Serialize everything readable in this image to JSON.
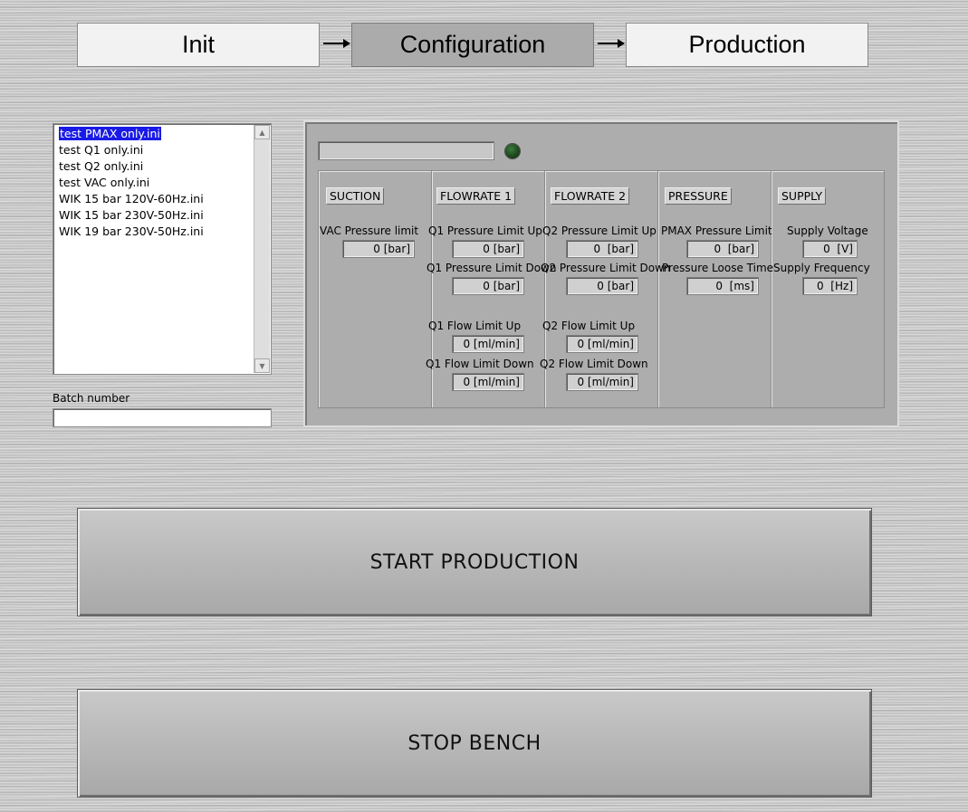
{
  "steps": [
    {
      "label": "Init",
      "active": false
    },
    {
      "label": "Configuration",
      "active": true
    },
    {
      "label": "Production",
      "active": false
    }
  ],
  "file_list": {
    "items": [
      "test PMAX only.ini",
      "test Q1 only.ini",
      "test Q2 only.ini",
      "test VAC only.ini",
      "WIK 15 bar 120V-60Hz.ini",
      "WIK 15 bar 230V-50Hz.ini",
      "WIK 19 bar 230V-50Hz.ini"
    ],
    "selected": "test PMAX only.ini"
  },
  "batch": {
    "label": "Batch number",
    "value": ""
  },
  "status": {
    "text": "",
    "led_color": "#1d4a1d"
  },
  "sections": {
    "suction": {
      "title": "SUCTION",
      "vac_label": "VAC Pressure limit",
      "vac_value": "0 [bar]"
    },
    "flowrate1": {
      "title": "FLOWRATE 1",
      "p_up_label": "Q1 Pressure Limit Up",
      "p_up_value": "0 [bar]",
      "p_down_label": "Q1 Pressure Limit Down",
      "p_down_value": "0 [bar]",
      "f_up_label": "Q1 Flow Limit Up",
      "f_up_value": "0 [ml/min]",
      "f_down_label": "Q1 Flow Limit Down",
      "f_down_value": "0 [ml/min]"
    },
    "flowrate2": {
      "title": "FLOWRATE 2",
      "p_up_label": "Q2 Pressure Limit Up",
      "p_up_value": "0  [bar]",
      "p_down_label": "Q2 Pressure Limit Down",
      "p_down_value": "0 [bar]",
      "f_up_label": "Q2 Flow Limit Up",
      "f_up_value": "0 [ml/min]",
      "f_down_label": "Q2 Flow Limit Down",
      "f_down_value": "0 [ml/min]"
    },
    "pressure": {
      "title": "PRESSURE",
      "pmax_label": "PMAX Pressure Limit",
      "pmax_value": "0  [bar]",
      "loose_label": "Pressure Loose Time",
      "loose_value": "0  [ms]"
    },
    "supply": {
      "title": "SUPPLY",
      "voltage_label": "Supply Voltage",
      "voltage_value": "0  [V]",
      "freq_label": "Supply Frequency",
      "freq_value": "0  [Hz]"
    }
  },
  "buttons": {
    "start": "START PRODUCTION",
    "stop": "STOP BENCH"
  }
}
